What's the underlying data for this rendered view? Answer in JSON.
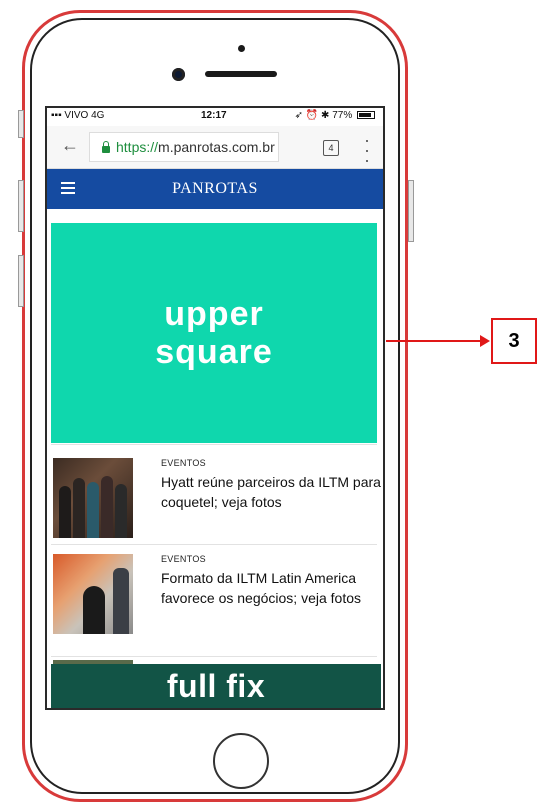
{
  "status_bar": {
    "carrier": "VIVO",
    "network": "4G",
    "time": "12:17",
    "battery": "77%"
  },
  "browser": {
    "url_scheme": "https://",
    "url_host": "m.panrotas.com.br",
    "tab_count": "4"
  },
  "site": {
    "logo": "PANROTAS",
    "brand_color": "#154ba1"
  },
  "ads": {
    "upper_square": "upper\nsquare",
    "upper_square_color": "#0fd7ad",
    "full_fix": "full fix",
    "full_fix_color": "#125446"
  },
  "articles": [
    {
      "category": "EVENTOS",
      "headline": "Hyatt reúne parceiros da ILTM para coquetel; veja fotos"
    },
    {
      "category": "EVENTOS",
      "headline": "Formato da ILTM Latin America favorece os negócios; veja fotos"
    }
  ],
  "callout": {
    "label": "3",
    "color": "#e01818"
  }
}
